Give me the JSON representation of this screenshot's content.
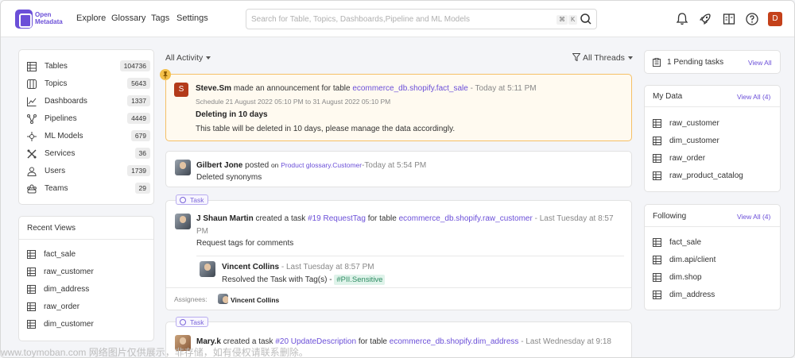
{
  "header": {
    "logo_text_line1": "Open",
    "logo_text_line2": "Metadata",
    "nav": [
      "Explore",
      "Glossary",
      "Tags",
      "Settings"
    ],
    "search_placeholder": "Search for Table, Topics, Dashboards,Pipeline and ML Models",
    "kbd1": "⌘",
    "kbd2": "K",
    "user_initial": "D"
  },
  "stats": [
    {
      "label": "Tables",
      "count": "104736",
      "icon": "table-icon"
    },
    {
      "label": "Topics",
      "count": "5643",
      "icon": "topic-icon"
    },
    {
      "label": "Dashboards",
      "count": "1337",
      "icon": "dashboard-icon"
    },
    {
      "label": "Pipelines",
      "count": "4449",
      "icon": "pipeline-icon"
    },
    {
      "label": "ML Models",
      "count": "679",
      "icon": "mlmodel-icon"
    },
    {
      "label": "Services",
      "count": "36",
      "icon": "services-icon"
    },
    {
      "label": "Users",
      "count": "1739",
      "icon": "user-icon"
    },
    {
      "label": "Teams",
      "count": "29",
      "icon": "teams-icon"
    }
  ],
  "recent_views": {
    "title": "Recent Views",
    "items": [
      "fact_sale",
      "raw_customer",
      "dim_address",
      "raw_order",
      "dim_customer"
    ]
  },
  "feed": {
    "filter_left": "All Activity",
    "filter_right": "All Threads",
    "announcement": {
      "initial": "S",
      "user": "Steve.Sm",
      "action": "made an announcement for table",
      "entity": "ecommerce_db.shopify.fact_sale",
      "time": "- Today at 5:11 PM",
      "schedule": "Schedule 21 August 2022 05:10 PM to 31 August 2022 05:10 PM",
      "title": "Deleting in 10 days",
      "body": "This table will be deleted in 10 days, please manage the data accordingly."
    },
    "post": {
      "user": "Gilbert Jone",
      "action": "posted",
      "on": "on",
      "entity": "Product glossary.Customer",
      "time": "-Today at 5:54 PM",
      "body": "Deleted synonyms"
    },
    "task1": {
      "tag": "Task",
      "user": "J Shaun Martin",
      "action": "created a task",
      "task_link": "#19 RequestTag",
      "for_table": "for table",
      "entity": "ecommerce_db.shopify.raw_customer",
      "time": "- Last Tuesday at 8:57",
      "time2": "PM",
      "body": "Request tags for comments",
      "reply_user": "Vincent Collins",
      "reply_time": "- Last Tuesday at 8:57 PM",
      "reply_body": "Resolved the Task with Tag(s) -",
      "reply_tag": "#PII.Sensitive",
      "assignees_label": "Assignees:",
      "assignee": "Vincent Collins"
    },
    "task2": {
      "tag": "Task",
      "user": "Mary.k",
      "action": "created a task",
      "task_link": "#20 UpdateDescription",
      "for_table": "for table",
      "entity": "ecommerce_db.shopify.dim_address",
      "time": "- Last Wednesday at 9:18"
    }
  },
  "right": {
    "pending": {
      "label": "1 Pending tasks",
      "link": "View All"
    },
    "my_data": {
      "title": "My Data",
      "link": "View All (4)",
      "items": [
        "raw_customer",
        "dim_customer",
        "raw_order",
        "raw_product_catalog"
      ]
    },
    "following": {
      "title": "Following",
      "link": "View All (4)",
      "items": [
        "fact_sale",
        "dim.api/client",
        "dim.shop",
        "dim_address"
      ]
    }
  },
  "watermark": "www.toymoban.com 网络图片仅供展示，非存储，如有侵权请联系删除。"
}
